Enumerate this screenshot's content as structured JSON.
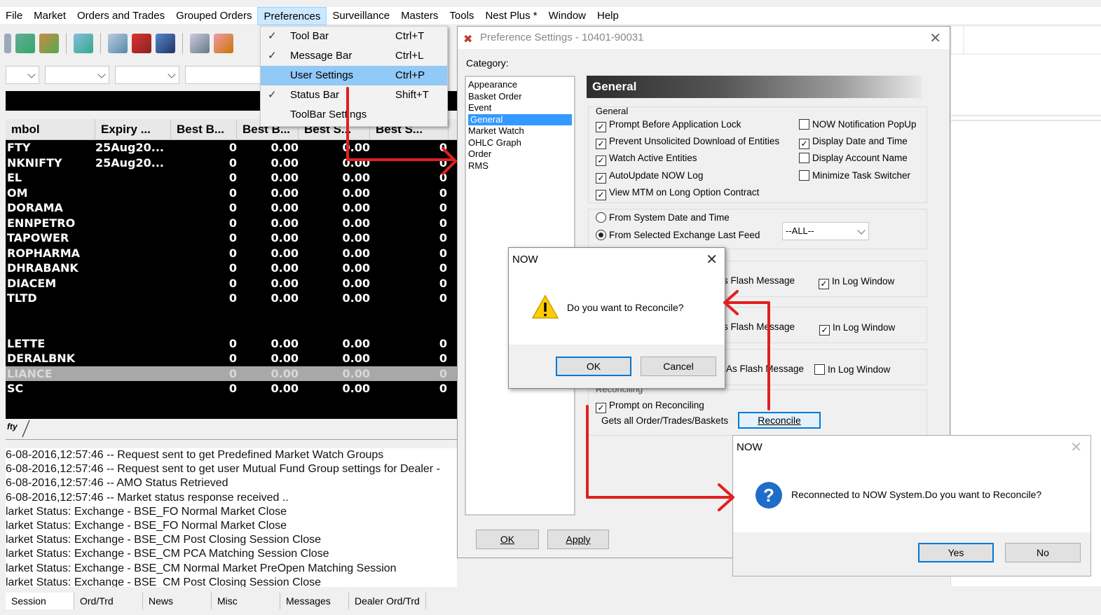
{
  "menubar": {
    "items": [
      "File",
      "Market",
      "Orders and Trades",
      "Grouped Orders",
      "Preferences",
      "Surveillance",
      "Masters",
      "Tools",
      "Nest Plus *",
      "Window",
      "Help"
    ]
  },
  "preferences_menu": {
    "items": [
      {
        "label": "Tool Bar",
        "shortcut": "Ctrl+T",
        "checked": "✓"
      },
      {
        "label": "Message Bar",
        "shortcut": "Ctrl+L",
        "checked": "✓"
      },
      {
        "label": "User Settings",
        "shortcut": "Ctrl+P",
        "checked": ""
      },
      {
        "label": "Status Bar",
        "shortcut": "Shift+T",
        "checked": "✓"
      },
      {
        "label": "ToolBar Settings",
        "shortcut": "",
        "checked": ""
      }
    ]
  },
  "market_watch": {
    "columns": [
      "mbol",
      "Expiry ...",
      "Best B...",
      "Best B...",
      "Best S...",
      "Best S..."
    ],
    "rows": [
      {
        "symbol": "FTY",
        "expiry": "25Aug20...",
        "bb_qty": "0",
        "bb_price": "0.00",
        "bs_price": "0.00",
        "bs_qty": "0"
      },
      {
        "symbol": "NKNIFTY",
        "expiry": "25Aug20...",
        "bb_qty": "0",
        "bb_price": "0.00",
        "bs_price": "0.00",
        "bs_qty": "0"
      },
      {
        "symbol": "EL",
        "expiry": "",
        "bb_qty": "0",
        "bb_price": "0.00",
        "bs_price": "0.00",
        "bs_qty": "0"
      },
      {
        "symbol": "OM",
        "expiry": "",
        "bb_qty": "0",
        "bb_price": "0.00",
        "bs_price": "0.00",
        "bs_qty": "0"
      },
      {
        "symbol": "DORAMA",
        "expiry": "",
        "bb_qty": "0",
        "bb_price": "0.00",
        "bs_price": "0.00",
        "bs_qty": "0"
      },
      {
        "symbol": "ENNPETRO",
        "expiry": "",
        "bb_qty": "0",
        "bb_price": "0.00",
        "bs_price": "0.00",
        "bs_qty": "0"
      },
      {
        "symbol": "TAPOWER",
        "expiry": "",
        "bb_qty": "0",
        "bb_price": "0.00",
        "bs_price": "0.00",
        "bs_qty": "0"
      },
      {
        "symbol": "ROPHARMA",
        "expiry": "",
        "bb_qty": "0",
        "bb_price": "0.00",
        "bs_price": "0.00",
        "bs_qty": "0"
      },
      {
        "symbol": "DHRABANK",
        "expiry": "",
        "bb_qty": "0",
        "bb_price": "0.00",
        "bs_price": "0.00",
        "bs_qty": "0"
      },
      {
        "symbol": "DIACEM",
        "expiry": "",
        "bb_qty": "0",
        "bb_price": "0.00",
        "bs_price": "0.00",
        "bs_qty": "0"
      },
      {
        "symbol": "TLTD",
        "expiry": "",
        "bb_qty": "0",
        "bb_price": "0.00",
        "bs_price": "0.00",
        "bs_qty": "0"
      },
      {
        "symbol": "",
        "expiry": "",
        "bb_qty": "",
        "bb_price": "",
        "bs_price": "",
        "bs_qty": ""
      },
      {
        "symbol": "",
        "expiry": "",
        "bb_qty": "",
        "bb_price": "",
        "bs_price": "",
        "bs_qty": ""
      },
      {
        "symbol": "LETTE",
        "expiry": "",
        "bb_qty": "0",
        "bb_price": "0.00",
        "bs_price": "0.00",
        "bs_qty": "0"
      },
      {
        "symbol": "DERALBNK",
        "expiry": "",
        "bb_qty": "0",
        "bb_price": "0.00",
        "bs_price": "0.00",
        "bs_qty": "0"
      },
      {
        "symbol": "LIANCE",
        "expiry": "",
        "bb_qty": "0",
        "bb_price": "0.00",
        "bs_price": "0.00",
        "bs_qty": "0",
        "selected": true
      },
      {
        "symbol": "SC",
        "expiry": "",
        "bb_qty": "0",
        "bb_price": "0.00",
        "bs_price": "0.00",
        "bs_qty": "0"
      }
    ],
    "tab_label": "fty"
  },
  "log": {
    "lines": [
      "6-08-2016,12:57:46  -- Request sent to get Predefined Market Watch Groups",
      "6-08-2016,12:57:46  -- Request sent to get user Mutual Fund Group settings for Dealer -",
      "6-08-2016,12:57:46  -- AMO Status Retrieved",
      "6-08-2016,12:57:46  -- Market status response received ..",
      "larket Status: Exchange - BSE_FO Normal Market Close",
      "larket Status: Exchange - BSE_FO Normal Market Close",
      "larket Status: Exchange - BSE_CM Post Closing Session Close",
      "larket Status: Exchange - BSE_CM PCA Matching Session Close",
      "larket Status: Exchange - BSE_CM Normal Market PreOpen Matching Session",
      "larket Status: Exchange - BSE_CM Post Closing Session Close"
    ]
  },
  "bottom_tabs": [
    "Session",
    "Ord/Trd",
    "News",
    "Misc",
    "Messages",
    "Dealer Ord/Trd"
  ],
  "pref_dialog": {
    "title": "Preference Settings - 10401-90031",
    "category_label": "Category:",
    "categories": [
      "Appearance",
      "Basket Order",
      "Event",
      "General",
      "Market Watch",
      "OHLC Graph",
      "Order",
      "RMS"
    ],
    "selected_category": "General",
    "section_header": "General",
    "general_group_title": "General",
    "left_checks": [
      {
        "label": "Prompt Before Application Lock",
        "mark": "✓"
      },
      {
        "label": "Prevent Unsolicited Download of Entities",
        "mark": "✓"
      },
      {
        "label": "Watch Active Entities",
        "mark": "✓"
      },
      {
        "label": "AutoUpdate NOW Log",
        "mark": "✓"
      },
      {
        "label": "View MTM on Long Option Contract",
        "mark": "✓"
      }
    ],
    "right_checks": [
      {
        "label": "NOW Notification PopUp",
        "mark": ""
      },
      {
        "label": "Display Date and Time",
        "mark": "✓"
      },
      {
        "label": "Display Account Name",
        "mark": ""
      },
      {
        "label": "Minimize Task Switcher",
        "mark": ""
      }
    ],
    "radio_system": "From System Date and Time",
    "radio_exchange": "From Selected Exchange Last Feed",
    "exchange_select": "--ALL--",
    "flash_rows": [
      {
        "flash": "s Flash Message",
        "log": "In Log Window",
        "log_mark": "✓"
      },
      {
        "flash": "s Flash Message",
        "log": "In Log Window",
        "log_mark": "✓"
      },
      {
        "flash": "As Flash Message",
        "log": "In Log Window",
        "log_mark": ""
      }
    ],
    "reconciling_group": "Reconciling",
    "prompt_reconciling": "Prompt on Reconciling",
    "gets_all": "Gets all Order/Trades/Baskets",
    "reconcile_button": "Reconcile",
    "ok_button": "OK",
    "apply_button": "Apply"
  },
  "now_dialog_1": {
    "title": "NOW",
    "message": "Do you want to Reconcile?",
    "ok": "OK",
    "cancel": "Cancel"
  },
  "now_dialog_2": {
    "title": "NOW",
    "message": "Reconnected to NOW System.Do you want to Reconcile?",
    "yes": "Yes",
    "no": "No"
  },
  "colors": {
    "selection_blue": "#3399ff",
    "menu_highlight": "#91c9f7",
    "arrow_red": "#e02020",
    "dialog_accent": "#0078d7"
  }
}
